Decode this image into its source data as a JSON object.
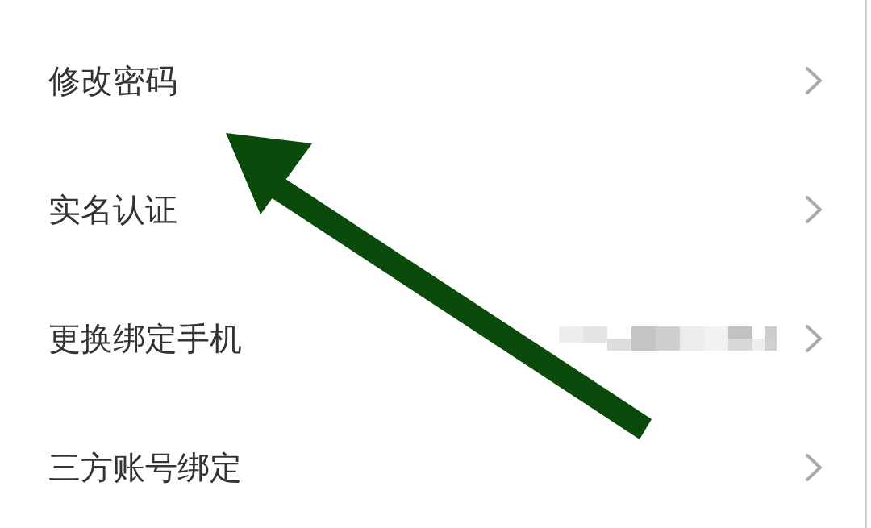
{
  "settings": [
    {
      "label": "修改密码",
      "masked_value": false
    },
    {
      "label": "实名认证",
      "masked_value": false
    },
    {
      "label": "更换绑定手机",
      "masked_value": true
    },
    {
      "label": "三方账号绑定",
      "masked_value": false
    }
  ],
  "annotation": {
    "kind": "arrow"
  }
}
